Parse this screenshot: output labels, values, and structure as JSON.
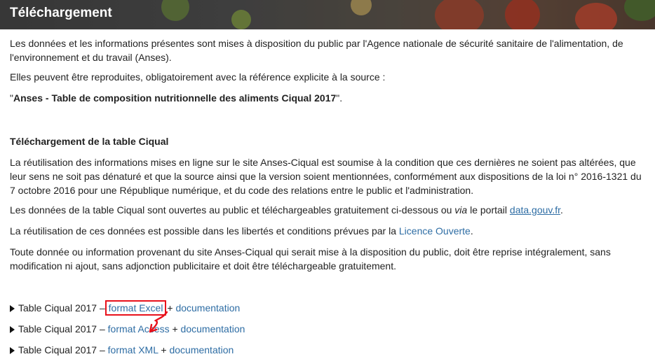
{
  "header": {
    "title": "Téléchargement"
  },
  "intro": {
    "p1": "Les données et les informations présentes sont mises à disposition du public par l'Agence nationale de sécurité sanitaire de l'alimentation, de l'environnement et du travail (Anses).",
    "p2": "Elles peuvent être reproduites, obligatoirement avec la référence explicite à la source :",
    "quote_open": "\"",
    "citation": "Anses - Table de composition nutritionnelle des aliments Ciqual 2017",
    "quote_close": "\"."
  },
  "section": {
    "title": "Téléchargement de la table Ciqual",
    "p1": "La réutilisation des informations mises en ligne sur le site Anses-Ciqual est soumise à la condition que ces dernières ne soient pas altérées, que leur sens ne soit pas dénaturé et que la source ainsi que la version soient mentionnées, conformément aux dispositions de la loi n° 2016-1321 du 7 octobre 2016 pour une République numérique, et du code des relations entre le public et l'administration.",
    "p2_before": "Les données de la table Ciqual sont ouvertes au public et téléchargeables gratuitement ci-dessous ou ",
    "p2_via": "via",
    "p2_mid": " le portail ",
    "p2_link": "data.gouv.fr",
    "p2_end": ".",
    "p3_before": "La réutilisation de ces données est possible dans les libertés et conditions prévues par la ",
    "p3_link": "Licence Ouverte",
    "p3_end": ".",
    "p4": "Toute donnée ou information provenant du site Anses-Ciqual qui serait mise à la disposition du public, doit être reprise intégralement, sans modification ni ajout, sans adjonction publicitaire et doit être téléchargeable gratuitement."
  },
  "downloads": [
    {
      "label": "Table Ciqual 2017 – ",
      "format": "format Excel",
      "plus": " + ",
      "doc": "documentation"
    },
    {
      "label": "Table Ciqual 2017 – ",
      "format": "format Access",
      "plus": " + ",
      "doc": "documentation"
    },
    {
      "label": "Table Ciqual 2017 – ",
      "format": "format XML",
      "plus": " + ",
      "doc": "documentation"
    }
  ],
  "colors": {
    "link": "#2e6da4",
    "highlight": "#e8111b"
  }
}
